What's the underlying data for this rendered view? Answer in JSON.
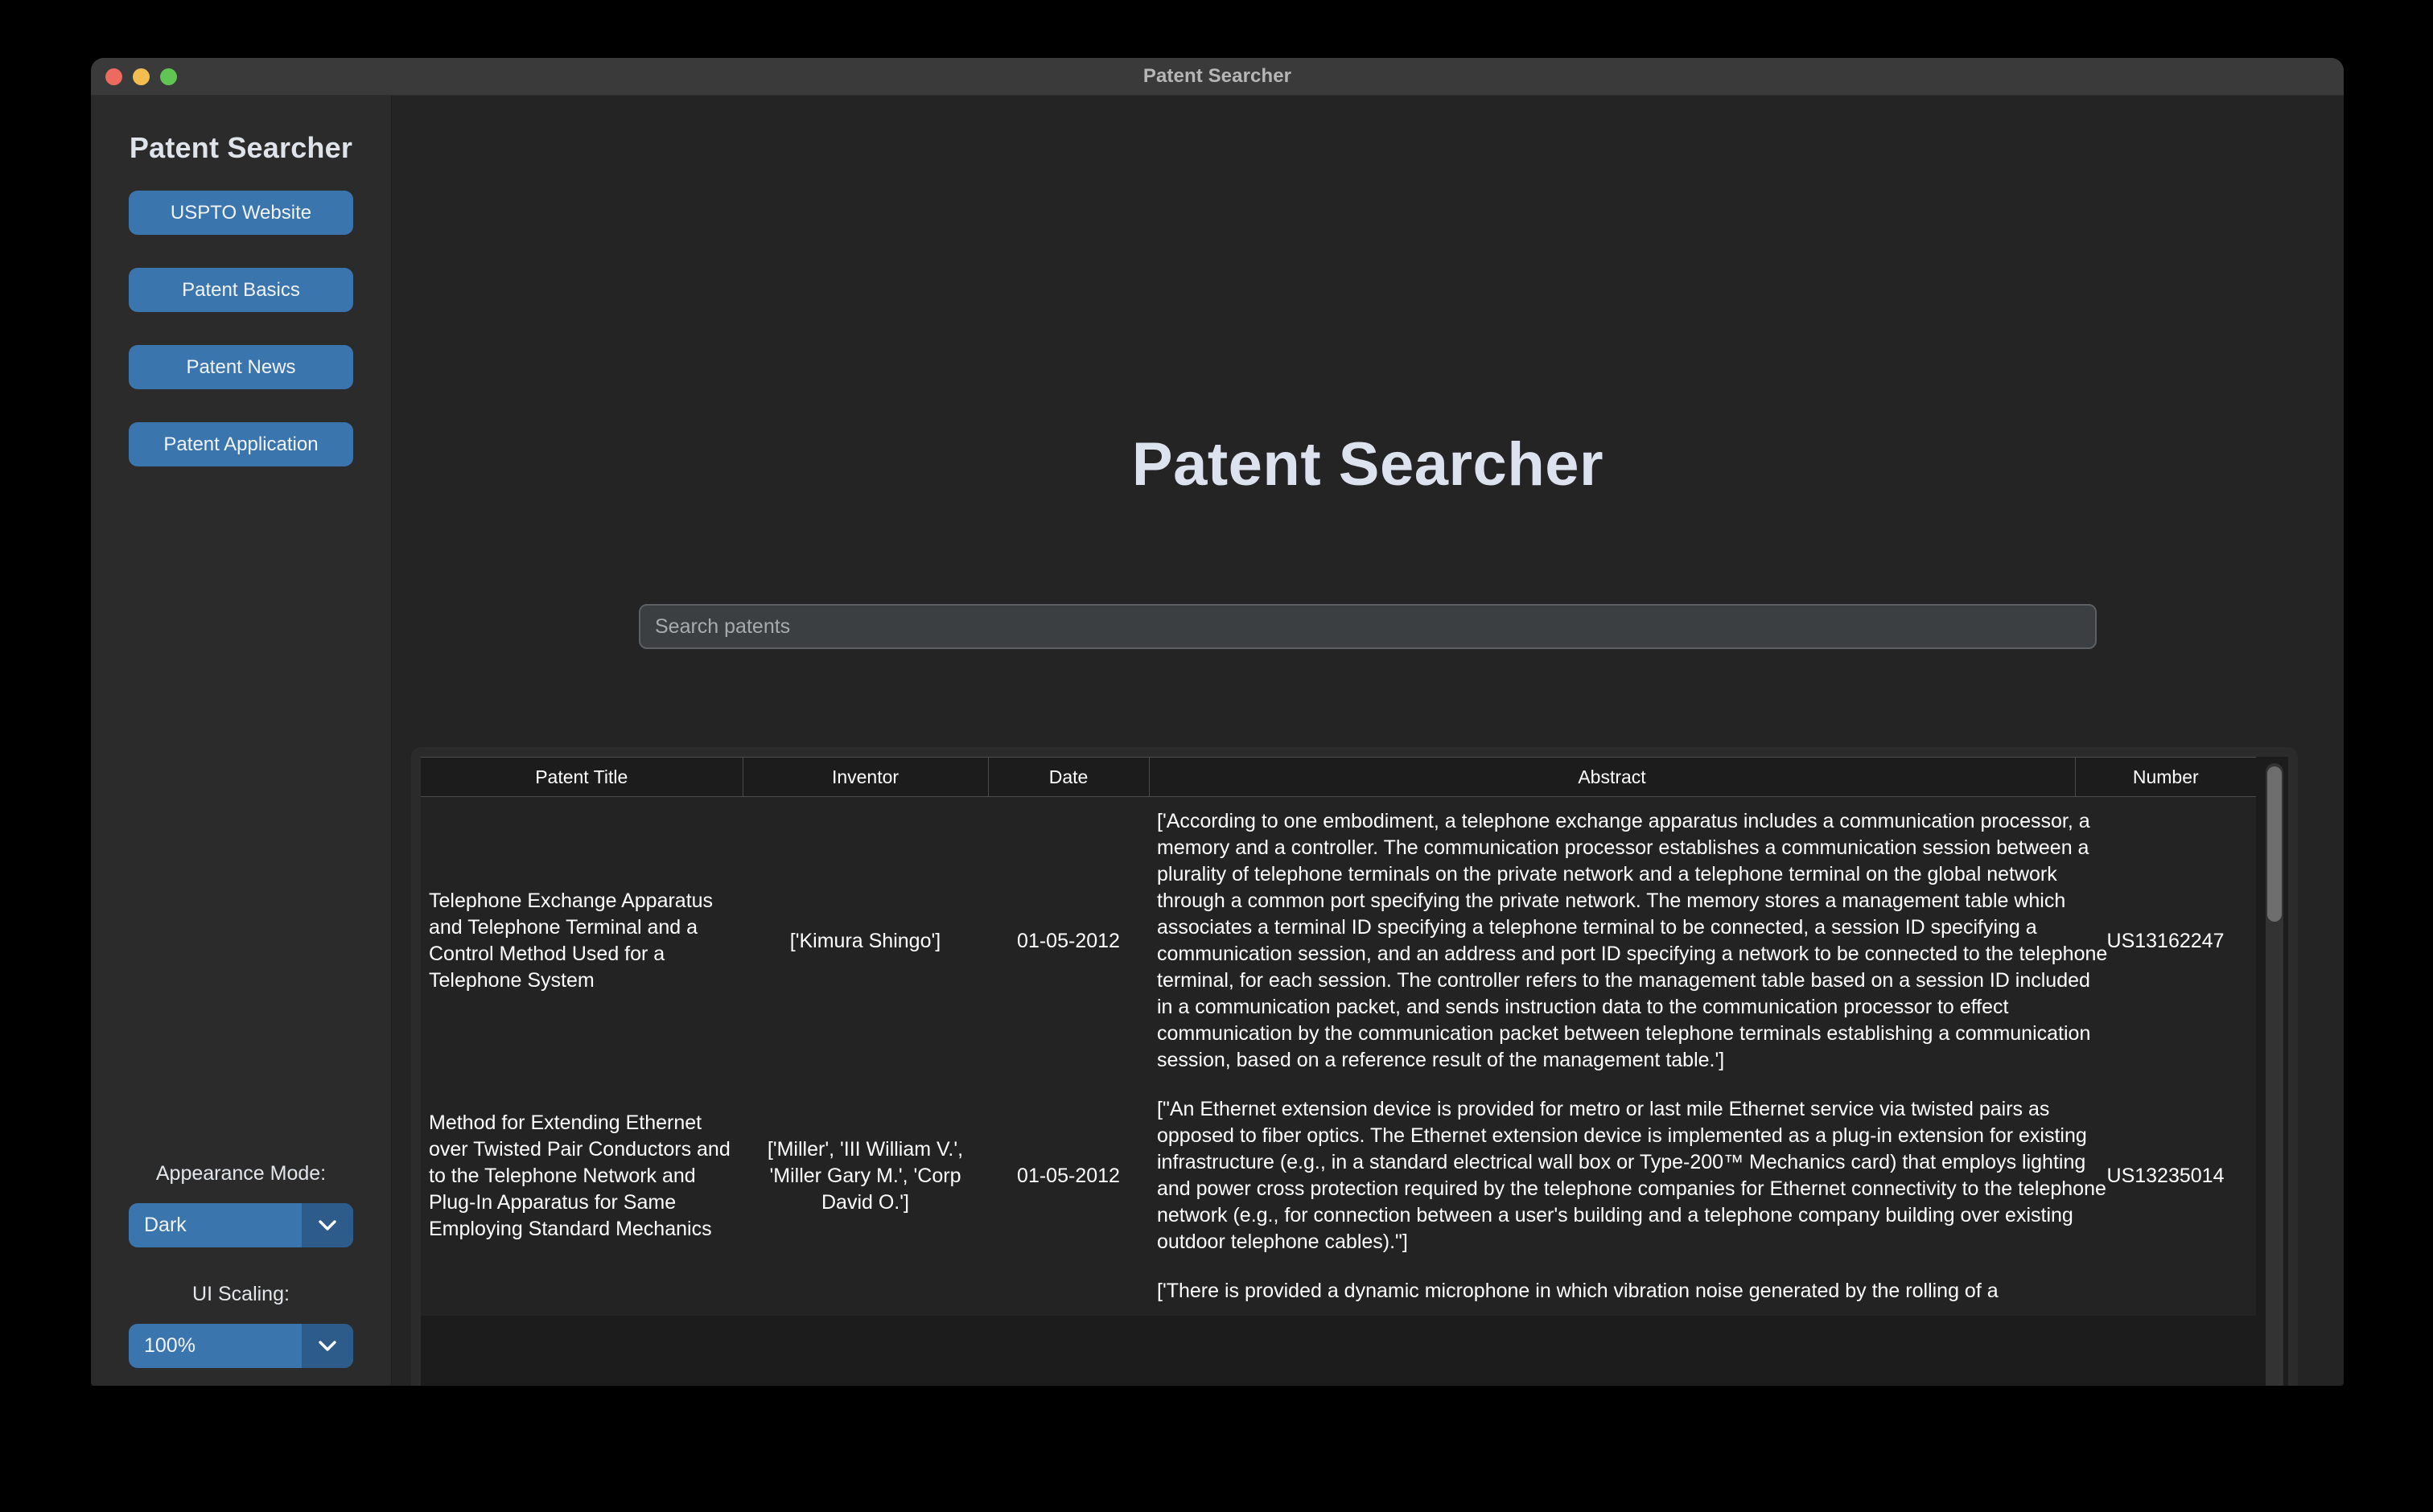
{
  "window": {
    "title": "Patent Searcher",
    "traffic_lights": [
      "close",
      "minimize",
      "zoom"
    ]
  },
  "sidebar": {
    "title": "Patent Searcher",
    "nav_buttons": [
      {
        "label": "USPTO Website"
      },
      {
        "label": "Patent Basics"
      },
      {
        "label": "Patent News"
      },
      {
        "label": "Patent Application"
      }
    ],
    "appearance": {
      "label": "Appearance Mode:",
      "value": "Dark",
      "icon": "chevron-down-icon"
    },
    "ui_scaling": {
      "label": "UI Scaling:",
      "value": "100%",
      "icon": "chevron-down-icon"
    }
  },
  "main": {
    "hero_title": "Patent Searcher",
    "search": {
      "value": "",
      "placeholder": "Search patents"
    },
    "table": {
      "columns": [
        "Patent Title",
        "Inventor",
        "Date",
        "Abstract",
        "Number"
      ],
      "rows": [
        {
          "title": "Telephone Exchange Apparatus and Telephone Terminal and a Control Method Used for a Telephone System",
          "inventor": "['Kimura Shingo']",
          "date": "01-05-2012",
          "abstract": "['According to one embodiment, a telephone exchange apparatus includes a communication processor, a memory and a controller. The communication processor establishes a communication session between a plurality of telephone terminals on the private network and a telephone terminal on the global network through a common port specifying the private network. The memory stores a management table which associates a terminal ID specifying a telephone terminal to be connected, a session ID specifying a communication session, and an address and port ID specifying a network to be connected to the telephone terminal, for each session. The controller refers to the management table based on a session ID included in a communication packet, and sends instruction data to the communication processor to effect communication by the communication packet between telephone terminals establishing a communication session, based on a reference result of the management table.']",
          "number": "US13162247"
        },
        {
          "title": "Method for Extending Ethernet over Twisted Pair Conductors and to the Telephone Network and Plug-In Apparatus for Same Employing Standard Mechanics",
          "inventor": "['Miller', 'III William V.', 'Miller Gary M.', 'Corp David O.']",
          "date": "01-05-2012",
          "abstract": "[\"An Ethernet extension device is provided for metro or last mile Ethernet service via twisted pairs as opposed to fiber optics. The Ethernet extension device is implemented as a plug-in extension for existing infrastructure (e.g., in a standard electrical wall box or Type-200™ Mechanics card) that employs lighting and power cross protection required by the telephone companies for Ethernet connectivity to the telephone network (e.g., for connection between a user's building and a telephone company building over existing outdoor telephone cables).\"]",
          "number": "US13235014"
        },
        {
          "title": "",
          "inventor": "",
          "date": "",
          "abstract": "['There is provided a dynamic microphone in which vibration noise generated by the rolling of a",
          "number": ""
        }
      ]
    },
    "scrollbar": {
      "orientation": "vertical",
      "position": "top"
    }
  },
  "colors": {
    "accent": "#3b75ad",
    "accent_dark": "#2e5c8a",
    "sidebar_bg": "#2b2b2b",
    "main_bg": "#242424",
    "table_bg": "#1c1c1c",
    "row_bg": "#232323",
    "text": "#ffffff",
    "heading": "#dde2ef"
  }
}
